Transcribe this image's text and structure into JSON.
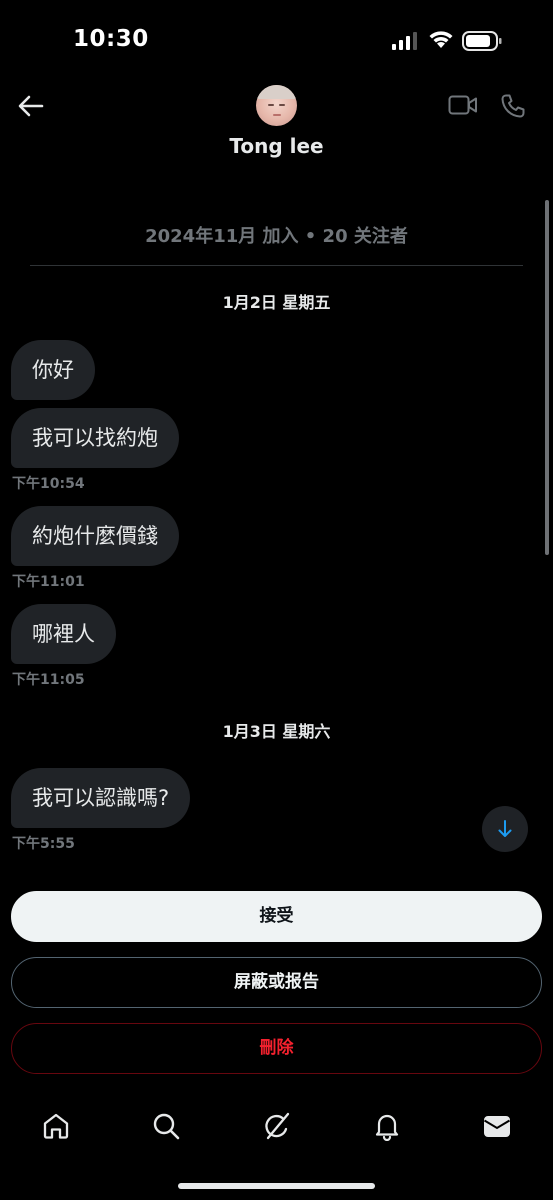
{
  "status_bar": {
    "time": "10:30"
  },
  "header": {
    "contact_name": "Tong lee",
    "joined_info": "2024年11月 加入 • 20 关注者"
  },
  "conversation": {
    "day1_label": "1月2日 星期五",
    "messages_day1": [
      {
        "text": "你好"
      },
      {
        "text": "我可以找約炮",
        "time": "下午10:54"
      },
      {
        "text": "約炮什麼價錢",
        "time": "下午11:01"
      },
      {
        "text": "哪裡人",
        "time": "下午11:05"
      }
    ],
    "day2_label": "1月3日 星期六",
    "messages_day2": [
      {
        "text": "我可以認識嗎?",
        "time": "下午5:55"
      }
    ]
  },
  "actions": {
    "accept_label": "接受",
    "block_report_label": "屏蔽或报告",
    "delete_label": "刪除"
  },
  "icons": {
    "back": "arrow-left-icon",
    "video_call": "video-camera-icon",
    "voice_call": "phone-icon",
    "scroll_down": "arrow-down-icon",
    "nav": [
      "home-icon",
      "search-icon",
      "grok-icon",
      "bell-icon",
      "mail-icon"
    ]
  },
  "colors": {
    "background": "#000000",
    "bubble": "#202327",
    "accent_blue": "#1d9bf0",
    "danger_red": "#f4212e",
    "muted_text": "#71767b"
  }
}
